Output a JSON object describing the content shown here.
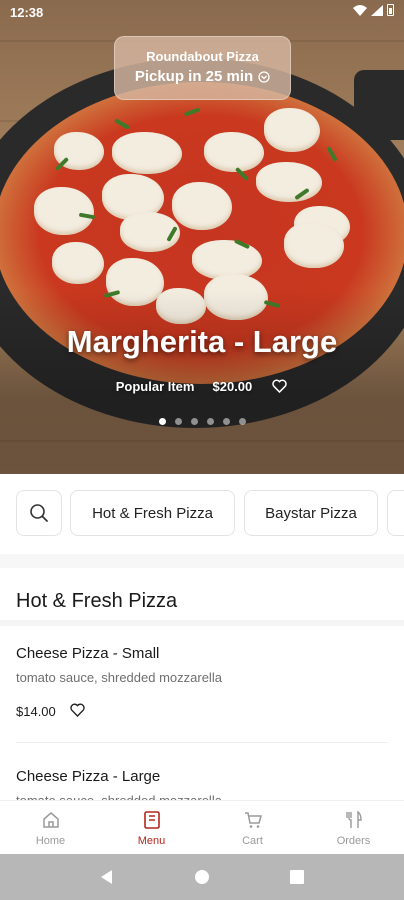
{
  "status_bar": {
    "time": "12:38"
  },
  "store": {
    "name": "Roundabout Pizza",
    "pickup": "Pickup in 25 min"
  },
  "hero": {
    "title": "Margherita - Large",
    "badge": "Popular Item",
    "price": "$20.00",
    "carousel_count": 6,
    "carousel_active_index": 0
  },
  "categories": {
    "search_icon": "search-icon",
    "chips": [
      "Hot & Fresh Pizza",
      "Baystar Pizza",
      ""
    ]
  },
  "section": {
    "title": "Hot & Fresh Pizza"
  },
  "items": [
    {
      "name": "Cheese Pizza - Small",
      "description": "tomato sauce, shredded mozzarella",
      "price": "$14.00"
    },
    {
      "name": "Cheese Pizza - Large",
      "description": "tomato sauce, shredded mozzarella",
      "price": ""
    }
  ],
  "bottom_nav": [
    {
      "label": "Home",
      "icon": "home-icon",
      "active": false
    },
    {
      "label": "Menu",
      "icon": "menu-icon",
      "active": true
    },
    {
      "label": "Cart",
      "icon": "cart-icon",
      "active": false
    },
    {
      "label": "Orders",
      "icon": "orders-icon",
      "active": false
    }
  ],
  "colors": {
    "accent": "#b3261e",
    "muted": "#9a9a9a",
    "system_nav": "#b7b7b7"
  }
}
